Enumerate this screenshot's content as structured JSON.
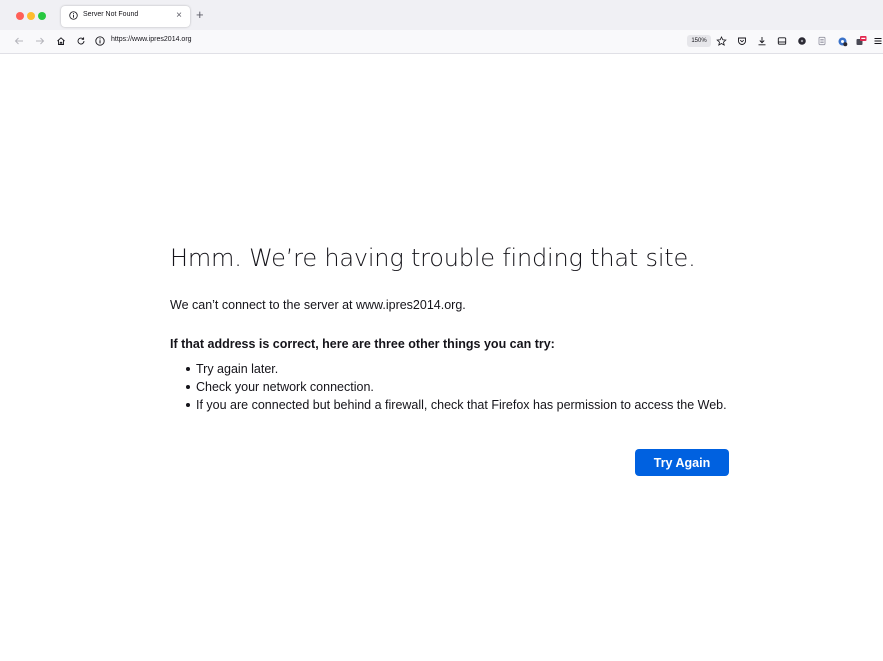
{
  "browser": {
    "tab": {
      "icon": "info-circle-icon",
      "title": "Server Not Found",
      "close_icon": "close-icon",
      "close_glyph": "×"
    },
    "new_tab_icon": "plus-icon",
    "new_tab_glyph": "+",
    "nav": {
      "back_icon": "back-arrow-icon",
      "forward_icon": "forward-arrow-icon",
      "home_icon": "home-icon",
      "reload_icon": "reload-icon"
    },
    "url": {
      "security_icon": "info-circle-icon",
      "text": "https://www.ipres2014.org"
    },
    "zoom_level": "150%",
    "toolbar_icons": [
      "bookmark-star-icon",
      "pocket-icon",
      "downloads-icon",
      "sidebar-icon",
      "extension-dark-circle-icon",
      "reader-icon",
      "extension-gear-icon",
      "extension-red-badge-icon",
      "hamburger-menu-icon"
    ]
  },
  "error_page": {
    "title": "Hmm. We’re having trouble finding that site.",
    "description": "We can’t connect to the server at www.ipres2014.org.",
    "suggestions_heading": "If that address is correct, here are three other things you can try:",
    "suggestions": [
      "Try again later.",
      "Check your network connection.",
      "If you are connected but behind a firewall, check that Firefox has permission to access the Web."
    ],
    "try_again_label": "Try Again"
  },
  "colors": {
    "primary_button": "#0061e0",
    "tab_bar": "#f0f0f4",
    "nav_bar": "#f9f9fb",
    "text": "#15141a"
  }
}
